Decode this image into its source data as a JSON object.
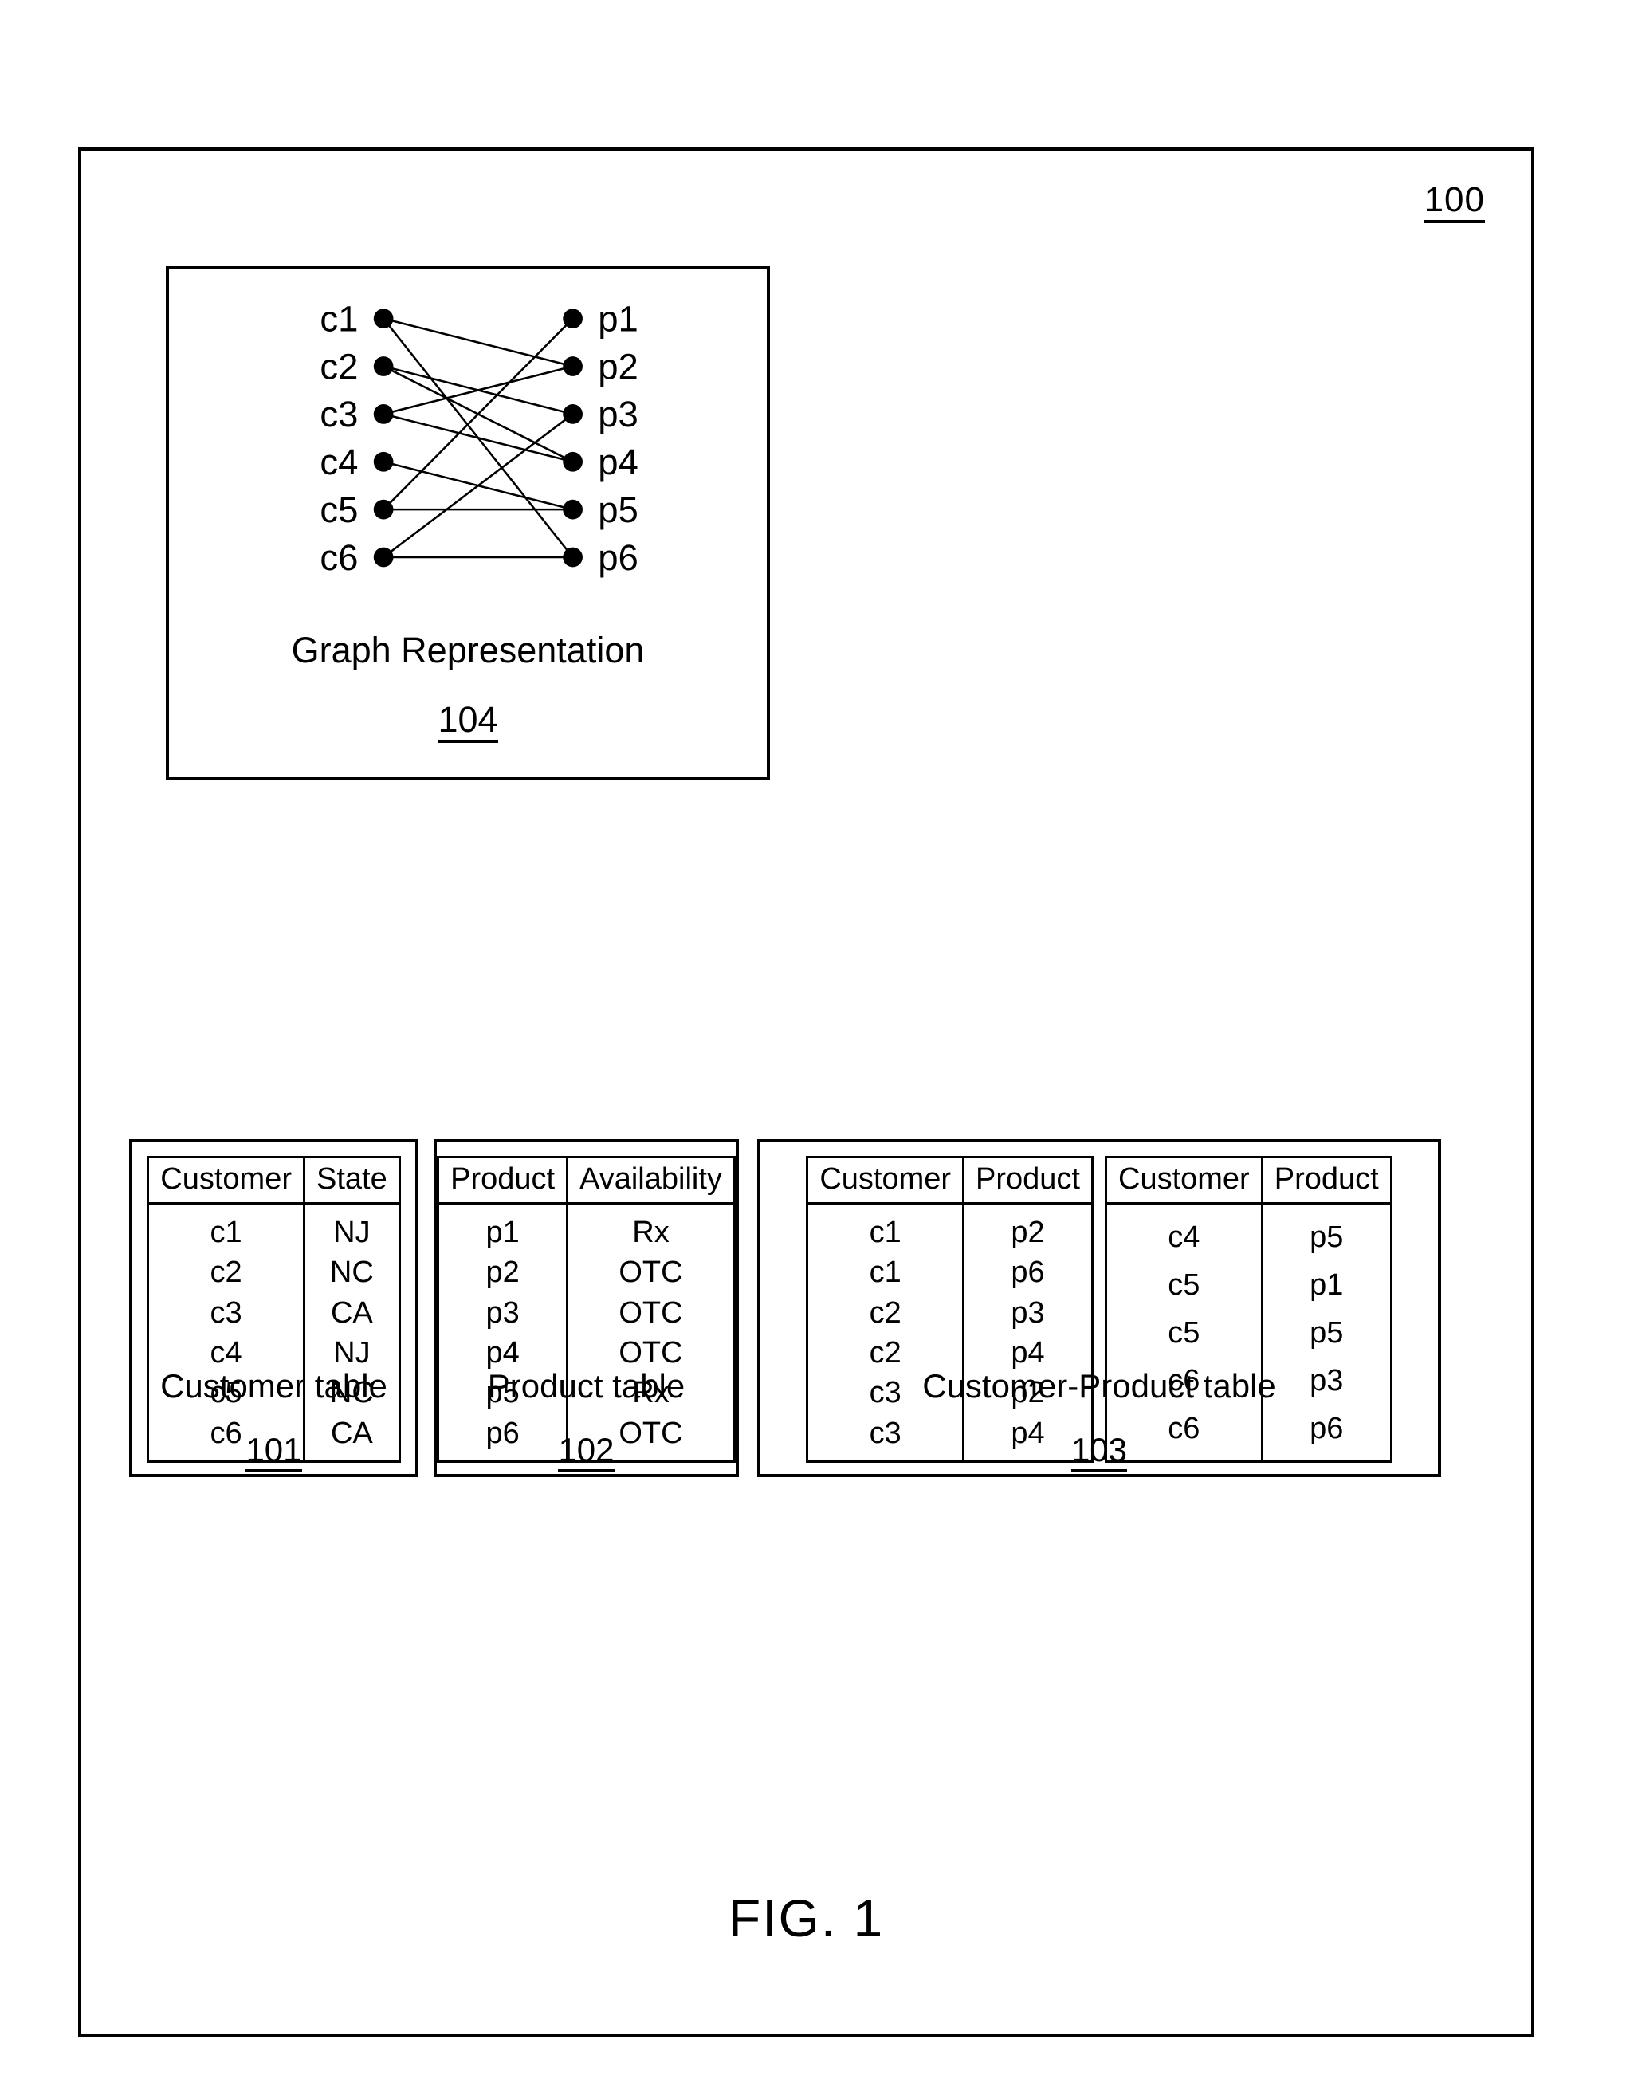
{
  "figure": {
    "ref_numeral": "100",
    "title": "FIG. 1"
  },
  "graph_panel": {
    "caption_title": "Graph Representation",
    "caption_number": "104",
    "left_nodes": [
      "c1",
      "c2",
      "c3",
      "c4",
      "c5",
      "c6"
    ],
    "right_nodes": [
      "p1",
      "p2",
      "p3",
      "p4",
      "p5",
      "p6"
    ],
    "edges": [
      {
        "from": "c1",
        "to": "p2"
      },
      {
        "from": "c1",
        "to": "p6"
      },
      {
        "from": "c2",
        "to": "p3"
      },
      {
        "from": "c2",
        "to": "p4"
      },
      {
        "from": "c3",
        "to": "p2"
      },
      {
        "from": "c3",
        "to": "p4"
      },
      {
        "from": "c4",
        "to": "p5"
      },
      {
        "from": "c5",
        "to": "p1"
      },
      {
        "from": "c5",
        "to": "p5"
      },
      {
        "from": "c6",
        "to": "p3"
      },
      {
        "from": "c6",
        "to": "p6"
      }
    ]
  },
  "customer_table": {
    "caption_title": "Customer table",
    "caption_number": "101",
    "headers": [
      "Customer",
      "State"
    ],
    "rows": [
      [
        "c1",
        "NJ"
      ],
      [
        "c2",
        "NC"
      ],
      [
        "c3",
        "CA"
      ],
      [
        "c4",
        "NJ"
      ],
      [
        "c5",
        "NC"
      ],
      [
        "c6",
        "CA"
      ]
    ]
  },
  "product_table": {
    "caption_title": "Product table",
    "caption_number": "102",
    "headers": [
      "Product",
      "Availability"
    ],
    "rows": [
      [
        "p1",
        "Rx"
      ],
      [
        "p2",
        "OTC"
      ],
      [
        "p3",
        "OTC"
      ],
      [
        "p4",
        "OTC"
      ],
      [
        "p5",
        "Rx"
      ],
      [
        "p6",
        "OTC"
      ]
    ]
  },
  "customer_product_table": {
    "caption_title": "Customer-Product table",
    "caption_number": "103",
    "headers": [
      "Customer",
      "Product"
    ],
    "rows_left": [
      [
        "c1",
        "p2"
      ],
      [
        "c1",
        "p6"
      ],
      [
        "c2",
        "p3"
      ],
      [
        "c2",
        "p4"
      ],
      [
        "c3",
        "p2"
      ],
      [
        "c3",
        "p4"
      ]
    ],
    "rows_right": [
      [
        "c4",
        "p5"
      ],
      [
        "c5",
        "p1"
      ],
      [
        "c5",
        "p5"
      ],
      [
        "c6",
        "p3"
      ],
      [
        "c6",
        "p6"
      ]
    ]
  }
}
